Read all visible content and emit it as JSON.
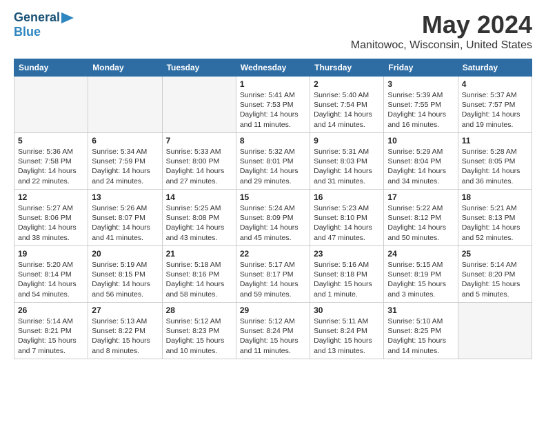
{
  "logo": {
    "general": "General",
    "blue": "Blue"
  },
  "header": {
    "month": "May 2024",
    "location": "Manitowoc, Wisconsin, United States"
  },
  "weekdays": [
    "Sunday",
    "Monday",
    "Tuesday",
    "Wednesday",
    "Thursday",
    "Friday",
    "Saturday"
  ],
  "weeks": [
    [
      {
        "day": "",
        "empty": true
      },
      {
        "day": "",
        "empty": true
      },
      {
        "day": "",
        "empty": true
      },
      {
        "day": "1",
        "sunrise": "5:41 AM",
        "sunset": "7:53 PM",
        "daylight": "14 hours and 11 minutes."
      },
      {
        "day": "2",
        "sunrise": "5:40 AM",
        "sunset": "7:54 PM",
        "daylight": "14 hours and 14 minutes."
      },
      {
        "day": "3",
        "sunrise": "5:39 AM",
        "sunset": "7:55 PM",
        "daylight": "14 hours and 16 minutes."
      },
      {
        "day": "4",
        "sunrise": "5:37 AM",
        "sunset": "7:57 PM",
        "daylight": "14 hours and 19 minutes."
      }
    ],
    [
      {
        "day": "5",
        "sunrise": "5:36 AM",
        "sunset": "7:58 PM",
        "daylight": "14 hours and 22 minutes."
      },
      {
        "day": "6",
        "sunrise": "5:34 AM",
        "sunset": "7:59 PM",
        "daylight": "14 hours and 24 minutes."
      },
      {
        "day": "7",
        "sunrise": "5:33 AM",
        "sunset": "8:00 PM",
        "daylight": "14 hours and 27 minutes."
      },
      {
        "day": "8",
        "sunrise": "5:32 AM",
        "sunset": "8:01 PM",
        "daylight": "14 hours and 29 minutes."
      },
      {
        "day": "9",
        "sunrise": "5:31 AM",
        "sunset": "8:03 PM",
        "daylight": "14 hours and 31 minutes."
      },
      {
        "day": "10",
        "sunrise": "5:29 AM",
        "sunset": "8:04 PM",
        "daylight": "14 hours and 34 minutes."
      },
      {
        "day": "11",
        "sunrise": "5:28 AM",
        "sunset": "8:05 PM",
        "daylight": "14 hours and 36 minutes."
      }
    ],
    [
      {
        "day": "12",
        "sunrise": "5:27 AM",
        "sunset": "8:06 PM",
        "daylight": "14 hours and 38 minutes."
      },
      {
        "day": "13",
        "sunrise": "5:26 AM",
        "sunset": "8:07 PM",
        "daylight": "14 hours and 41 minutes."
      },
      {
        "day": "14",
        "sunrise": "5:25 AM",
        "sunset": "8:08 PM",
        "daylight": "14 hours and 43 minutes."
      },
      {
        "day": "15",
        "sunrise": "5:24 AM",
        "sunset": "8:09 PM",
        "daylight": "14 hours and 45 minutes."
      },
      {
        "day": "16",
        "sunrise": "5:23 AM",
        "sunset": "8:10 PM",
        "daylight": "14 hours and 47 minutes."
      },
      {
        "day": "17",
        "sunrise": "5:22 AM",
        "sunset": "8:12 PM",
        "daylight": "14 hours and 50 minutes."
      },
      {
        "day": "18",
        "sunrise": "5:21 AM",
        "sunset": "8:13 PM",
        "daylight": "14 hours and 52 minutes."
      }
    ],
    [
      {
        "day": "19",
        "sunrise": "5:20 AM",
        "sunset": "8:14 PM",
        "daylight": "14 hours and 54 minutes."
      },
      {
        "day": "20",
        "sunrise": "5:19 AM",
        "sunset": "8:15 PM",
        "daylight": "14 hours and 56 minutes."
      },
      {
        "day": "21",
        "sunrise": "5:18 AM",
        "sunset": "8:16 PM",
        "daylight": "14 hours and 58 minutes."
      },
      {
        "day": "22",
        "sunrise": "5:17 AM",
        "sunset": "8:17 PM",
        "daylight": "14 hours and 59 minutes."
      },
      {
        "day": "23",
        "sunrise": "5:16 AM",
        "sunset": "8:18 PM",
        "daylight": "15 hours and 1 minute."
      },
      {
        "day": "24",
        "sunrise": "5:15 AM",
        "sunset": "8:19 PM",
        "daylight": "15 hours and 3 minutes."
      },
      {
        "day": "25",
        "sunrise": "5:14 AM",
        "sunset": "8:20 PM",
        "daylight": "15 hours and 5 minutes."
      }
    ],
    [
      {
        "day": "26",
        "sunrise": "5:14 AM",
        "sunset": "8:21 PM",
        "daylight": "15 hours and 7 minutes."
      },
      {
        "day": "27",
        "sunrise": "5:13 AM",
        "sunset": "8:22 PM",
        "daylight": "15 hours and 8 minutes."
      },
      {
        "day": "28",
        "sunrise": "5:12 AM",
        "sunset": "8:23 PM",
        "daylight": "15 hours and 10 minutes."
      },
      {
        "day": "29",
        "sunrise": "5:12 AM",
        "sunset": "8:24 PM",
        "daylight": "15 hours and 11 minutes."
      },
      {
        "day": "30",
        "sunrise": "5:11 AM",
        "sunset": "8:24 PM",
        "daylight": "15 hours and 13 minutes."
      },
      {
        "day": "31",
        "sunrise": "5:10 AM",
        "sunset": "8:25 PM",
        "daylight": "15 hours and 14 minutes."
      },
      {
        "day": "",
        "empty": true
      }
    ]
  ]
}
